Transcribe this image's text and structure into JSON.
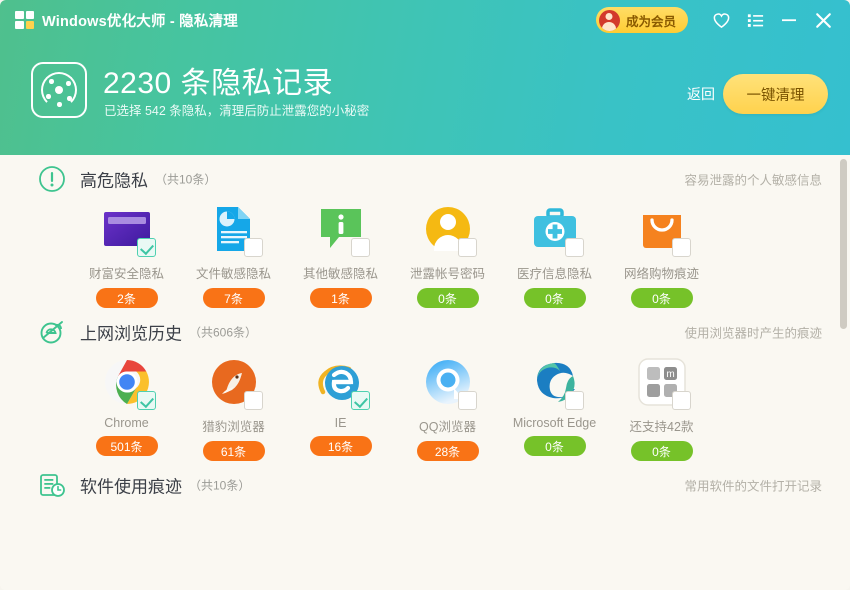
{
  "titlebar": {
    "app_title": "Windows优化大师 - 隐私清理",
    "logo_icon": "windows-squares-logo",
    "vip_label": "成为会员",
    "vip_avatar_icon": "user-avatar-icon",
    "favorite_icon": "heart-icon",
    "menu_icon": "list-menu-icon",
    "minimize_icon": "minimize-icon",
    "close_icon": "close-icon"
  },
  "banner": {
    "icon": "privacy-disc-icon",
    "title": "2230 条隐私记录",
    "subtitle": "已选择 542 条隐私，清理后防止泄露您的小秘密",
    "back_label": "返回",
    "clean_label": "一键清理"
  },
  "colors": {
    "header_start": "#4fc08d",
    "header_end": "#35c0cf",
    "accent_yellow": "#ffd24d",
    "badge_orange": "#f97316",
    "badge_green": "#76c229",
    "content_bg": "#faf8f2"
  },
  "sections": [
    {
      "icon": "warning-exclamation-icon",
      "title": "高危隐私",
      "count": "（共10条）",
      "desc": "容易泄露的个人敏感信息",
      "items": [
        {
          "icon": "credit-card-icon",
          "label": "财富安全隐私",
          "badge": "2条",
          "badge_color": "orange",
          "checked": true
        },
        {
          "icon": "document-chart-icon",
          "label": "文件敏感隐私",
          "badge": "7条",
          "badge_color": "orange",
          "checked": false
        },
        {
          "icon": "info-bubble-icon",
          "label": "其他敏感隐私",
          "badge": "1条",
          "badge_color": "orange",
          "checked": false
        },
        {
          "icon": "user-account-icon",
          "label": "泄露帐号密码",
          "badge": "0条",
          "badge_color": "green",
          "checked": false
        },
        {
          "icon": "medical-kit-icon",
          "label": "医疗信息隐私",
          "badge": "0条",
          "badge_color": "green",
          "checked": false
        },
        {
          "icon": "shopping-bag-icon",
          "label": "网络购物痕迹",
          "badge": "0条",
          "badge_color": "green",
          "checked": false
        }
      ]
    },
    {
      "icon": "browser-globe-icon",
      "title": "上网浏览历史",
      "count": "（共606条）",
      "desc": "使用浏览器时产生的痕迹",
      "items": [
        {
          "icon": "chrome-icon",
          "label": "Chrome",
          "badge": "501条",
          "badge_color": "orange",
          "checked": true
        },
        {
          "icon": "cheetah-icon",
          "label": "猎豹浏览器",
          "badge": "61条",
          "badge_color": "orange",
          "checked": false
        },
        {
          "icon": "ie-icon",
          "label": "IE",
          "badge": "16条",
          "badge_color": "orange",
          "checked": true
        },
        {
          "icon": "qq-browser-icon",
          "label": "QQ浏览器",
          "badge": "28条",
          "badge_color": "orange",
          "checked": false
        },
        {
          "icon": "edge-icon",
          "label": "Microsoft Edge",
          "badge": "0条",
          "badge_color": "green",
          "checked": false
        },
        {
          "icon": "more-browsers-icon",
          "label": "还支持42款",
          "badge": "0条",
          "badge_color": "green",
          "checked": false
        }
      ]
    },
    {
      "icon": "software-history-icon",
      "title": "软件使用痕迹",
      "count": "（共10条）",
      "desc": "常用软件的文件打开记录",
      "items": []
    }
  ]
}
